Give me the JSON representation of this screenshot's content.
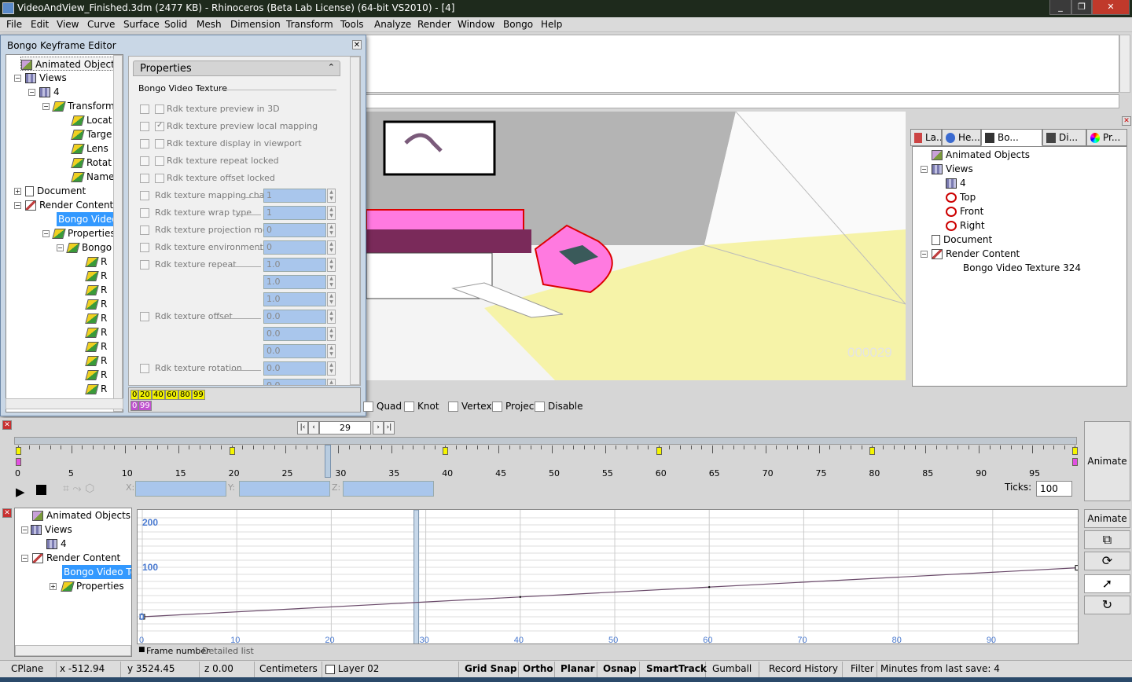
{
  "window": {
    "title": "VideoAndView_Finished.3dm (2477 KB) - Rhinoceros (Beta Lab License) (64-bit VS2010) - [4]",
    "min": "_",
    "max": "❐",
    "close": "✕"
  },
  "menu": [
    "File",
    "Edit",
    "View",
    "Curve",
    "Surface",
    "Solid",
    "Mesh",
    "Dimension",
    "Transform",
    "Tools",
    "Analyze",
    "Render",
    "Window",
    "Bongo",
    "Help"
  ],
  "keyframe_editor": {
    "title": "Bongo Keyframe Editor",
    "tree": [
      "Animated Objects",
      "Views",
      "4",
      "Transform",
      "Locat",
      "Targe",
      "Lens",
      "Rotat",
      "Name",
      "Document",
      "Render Content",
      "Bongo Video",
      "Properties",
      "Bongo",
      "R",
      "R",
      "R",
      "R",
      "R",
      "R",
      "R",
      "R",
      "R",
      "R",
      "R"
    ],
    "props_header": "Properties",
    "section": "Bongo Video Texture",
    "checks": [
      {
        "label": "Rdk texture preview in 3D",
        "checked": false
      },
      {
        "label": "Rdk texture preview local mapping",
        "checked": true
      },
      {
        "label": "Rdk texture display in viewport",
        "checked": false
      },
      {
        "label": "Rdk texture repeat locked",
        "checked": false
      },
      {
        "label": "Rdk texture offset locked",
        "checked": false
      }
    ],
    "fields": [
      {
        "label": "Rdk texture mapping chan...",
        "value": "1"
      },
      {
        "label": "Rdk texture wrap type",
        "value": "1"
      },
      {
        "label": "Rdk texture projection mode",
        "value": "0"
      },
      {
        "label": "Rdk texture environment ...",
        "value": "0"
      },
      {
        "label": "Rdk texture repeat",
        "value": "1.0"
      },
      {
        "label": "",
        "value": "1.0"
      },
      {
        "label": "",
        "value": "1.0"
      },
      {
        "label": "Rdk texture offset",
        "value": "0.0"
      },
      {
        "label": "",
        "value": "0.0"
      },
      {
        "label": "",
        "value": "0.0"
      },
      {
        "label": "Rdk texture rotation",
        "value": "0.0"
      },
      {
        "label": "",
        "value": "0.0"
      }
    ],
    "timeline_top": [
      "0",
      "20",
      "40",
      "60",
      "80",
      "99"
    ],
    "timeline_bottom": [
      "0",
      "99"
    ]
  },
  "viewport": {
    "frame_counter": "000029"
  },
  "right_panel": {
    "tabs": [
      "La...",
      "He...",
      "Bo...",
      "Di...",
      "Pr..."
    ],
    "tree": [
      "Animated Objects",
      "Views",
      "4",
      "Top",
      "Front",
      "Right",
      "Document",
      "Render Content",
      "Bongo Video Texture 324"
    ]
  },
  "osnap_opts": [
    "Quad",
    "Knot",
    "Vertex",
    "Project",
    "Disable"
  ],
  "animation": {
    "current_frame": "29",
    "tick_labels": [
      "0",
      "5",
      "10",
      "15",
      "20",
      "25",
      "30",
      "35",
      "40",
      "45",
      "50",
      "55",
      "60",
      "65",
      "70",
      "75",
      "80",
      "85",
      "90",
      "95"
    ],
    "ticks_label": "Ticks:",
    "ticks_value": "100",
    "animate": "Animate",
    "axes": [
      "X:",
      "Y:",
      "Z:"
    ]
  },
  "graph": {
    "tree": [
      "Animated Objects",
      "Views",
      "4",
      "Render Content",
      "Bongo Video Tex",
      "Properties"
    ],
    "y_labels": [
      "200",
      "100",
      "0"
    ],
    "x_labels": [
      "0",
      "10",
      "20",
      "30",
      "40",
      "50",
      "60",
      "70",
      "80",
      "90"
    ],
    "footer_tab1": "Frame number",
    "footer_tab2": "Detailed list",
    "animate": "Animate"
  },
  "status": {
    "cplane": "CPlane",
    "x": "x -512.94",
    "y": "y 3524.45",
    "z": "z 0.00",
    "units": "Centimeters",
    "layer": "Layer 02",
    "grid_snap": "Grid Snap",
    "ortho": "Ortho",
    "planar": "Planar",
    "osnap": "Osnap",
    "smarttrack": "SmartTrack",
    "gumball": "Gumball",
    "record_history": "Record History",
    "filter": "Filter",
    "save_info": "Minutes from last save: 4"
  }
}
